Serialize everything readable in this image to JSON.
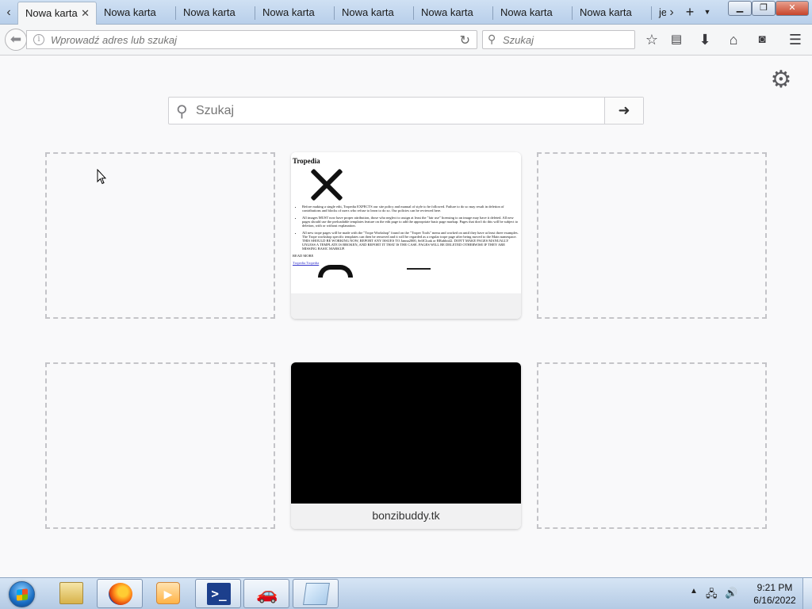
{
  "browser": {
    "tabs": [
      {
        "label": "Nowa karta",
        "active": true
      },
      {
        "label": "Nowa karta",
        "active": false
      },
      {
        "label": "Nowa karta",
        "active": false
      },
      {
        "label": "Nowa karta",
        "active": false
      },
      {
        "label": "Nowa karta",
        "active": false
      },
      {
        "label": "Nowa karta",
        "active": false
      },
      {
        "label": "Nowa karta",
        "active": false
      },
      {
        "label": "Nowa karta",
        "active": false
      },
      {
        "label": "je",
        "active": false
      }
    ],
    "tab_close_glyph": "✕",
    "new_tab_glyph": "+",
    "urlbar": {
      "placeholder": "Wprowadź adres lub szukaj",
      "value": ""
    },
    "searchbar": {
      "placeholder": "Szukaj",
      "value": ""
    },
    "toolbar_icons": [
      "bookmark-star-icon",
      "library-icon",
      "downloads-icon",
      "home-icon",
      "pocket-icon",
      "hamburger-menu-icon"
    ]
  },
  "newtab": {
    "search": {
      "placeholder": "Szukaj",
      "value": ""
    },
    "tiles": [
      {
        "state": "empty"
      },
      {
        "state": "thumbnail",
        "title": "",
        "thumbnail_site": "Tropedia"
      },
      {
        "state": "empty"
      },
      {
        "state": "empty"
      },
      {
        "state": "thumbnail",
        "title": "bonzibuddy.tk",
        "pinned": true
      },
      {
        "state": "empty"
      }
    ],
    "tropedia_preview": {
      "heading": "Tropedia",
      "bullets": [
        "Before making a single edit, Tropedia EXPECTS our site policy and manual of style to be followed. Failure to do so may result in deletion of contributions and blocks of users who refuse to learn to do so. Our policies can be reviewed here.",
        "All images MUST now have proper attribution, those who neglect to assign at least the \"fair use\" licensing to an image may have it deleted. All new pages should use the preloadable templates feature on the edit page to add the appropriate basic page markup. Pages that don't do this will be subject to deletion, with or without explanation.",
        "All new trope pages will be made with the \"Trope Workshop\" found on the \"Troper Tools\" menu and worked on until they have at least three examples. The Trope workshop specific templates can then be removed and it will be regarded as a regular trope page after being moved to the Main namespace. THIS SHOULD BE WORKING NOW, REPORT ANY ISSUES TO Janna2000, SelfCloak or RRabbit42. DON'T MAKE PAGES MANUALLY UNLESS A TEMPLATE IS BROKEN, AND REPORT IT THAT IS THE CASE. PAGES WILL BE DELETED OTHERWISE IF THEY ARE MISSING BASIC MARKUP."
      ],
      "read_more": "READ MORE",
      "link": "Tropedia Tropedia"
    }
  },
  "taskbar": {
    "apps": [
      "windows-explorer",
      "firefox",
      "media-player",
      "powershell",
      "car-app",
      "notepad"
    ],
    "clock": {
      "time": "9:21 PM",
      "date": "6/16/2022"
    }
  }
}
